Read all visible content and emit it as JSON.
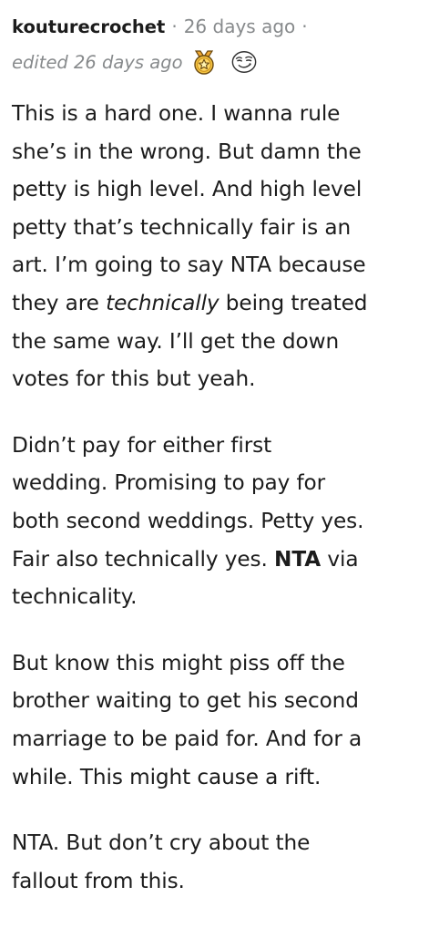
{
  "comment": {
    "username": "kouturecrochet",
    "separator": "·",
    "time_ago": "26 days ago",
    "trailing_separator": "·",
    "edited_label": "edited 26 days ago",
    "awards": [
      {
        "icon": "star-medal-award-icon"
      },
      {
        "icon": "smirk-face-award-icon"
      }
    ],
    "paragraphs": [
      {
        "lines": [
          [
            "This is a hard one. I wanna rule"
          ],
          [
            "she’s in the wrong. But damn the"
          ],
          [
            "petty is high level. And high level"
          ],
          [
            "petty that’s technically fair is an"
          ],
          [
            "art. I’m going to say NTA because"
          ],
          [
            "they are ",
            "technically",
            " being treated"
          ],
          [
            "the same way. I’ll get the down"
          ],
          [
            "votes for this but yeah."
          ]
        ]
      },
      {
        "lines": [
          [
            "Didn’t pay for either first"
          ],
          [
            "wedding. Promising to pay for"
          ],
          [
            "both second weddings. Petty yes."
          ],
          [
            "Fair also technically yes. ",
            "NTA",
            " via"
          ],
          [
            "technicality."
          ]
        ]
      },
      {
        "lines": [
          [
            "But know this might piss off the"
          ],
          [
            "brother waiting to get his second"
          ],
          [
            "marriage to be paid for. And for a"
          ],
          [
            "while. This might cause a rift."
          ]
        ]
      },
      {
        "lines": [
          [
            "NTA. But don’t cry about the"
          ],
          [
            "fallout from this."
          ]
        ]
      }
    ]
  },
  "colors": {
    "text": "#1c1c1c",
    "meta": "#878a8c",
    "award_gold": "#f5c542"
  }
}
